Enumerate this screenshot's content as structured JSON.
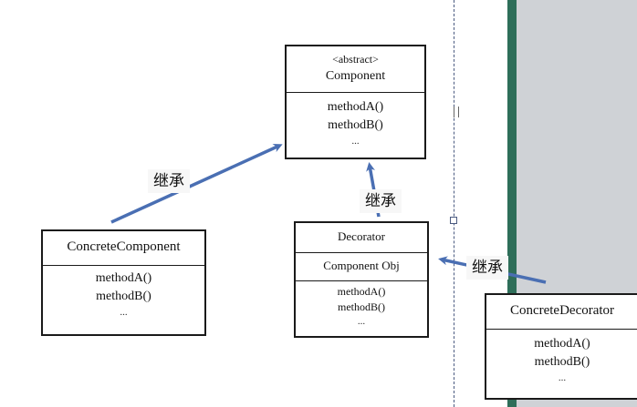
{
  "component": {
    "stereotype": "<abstract>",
    "name": "Component",
    "methods": [
      "methodA()",
      "methodB()",
      "..."
    ]
  },
  "concrete_component": {
    "name": "ConcreteComponent",
    "methods": [
      "methodA()",
      "methodB()",
      "..."
    ]
  },
  "decorator": {
    "name": "Decorator",
    "field": "Component Obj",
    "methods": [
      "methodA()",
      "methodB()",
      "..."
    ]
  },
  "concrete_decorator": {
    "name": "ConcreteDecorator",
    "methods": [
      "methodA()",
      "methodB()",
      "..."
    ]
  },
  "labels": {
    "inherit_1": "继承",
    "inherit_2": "继承",
    "inherit_3": "继承"
  },
  "colors": {
    "arrow": "#4a6fb3",
    "panel": "#cfd2d6",
    "panel_edge": "#2e6e59"
  }
}
